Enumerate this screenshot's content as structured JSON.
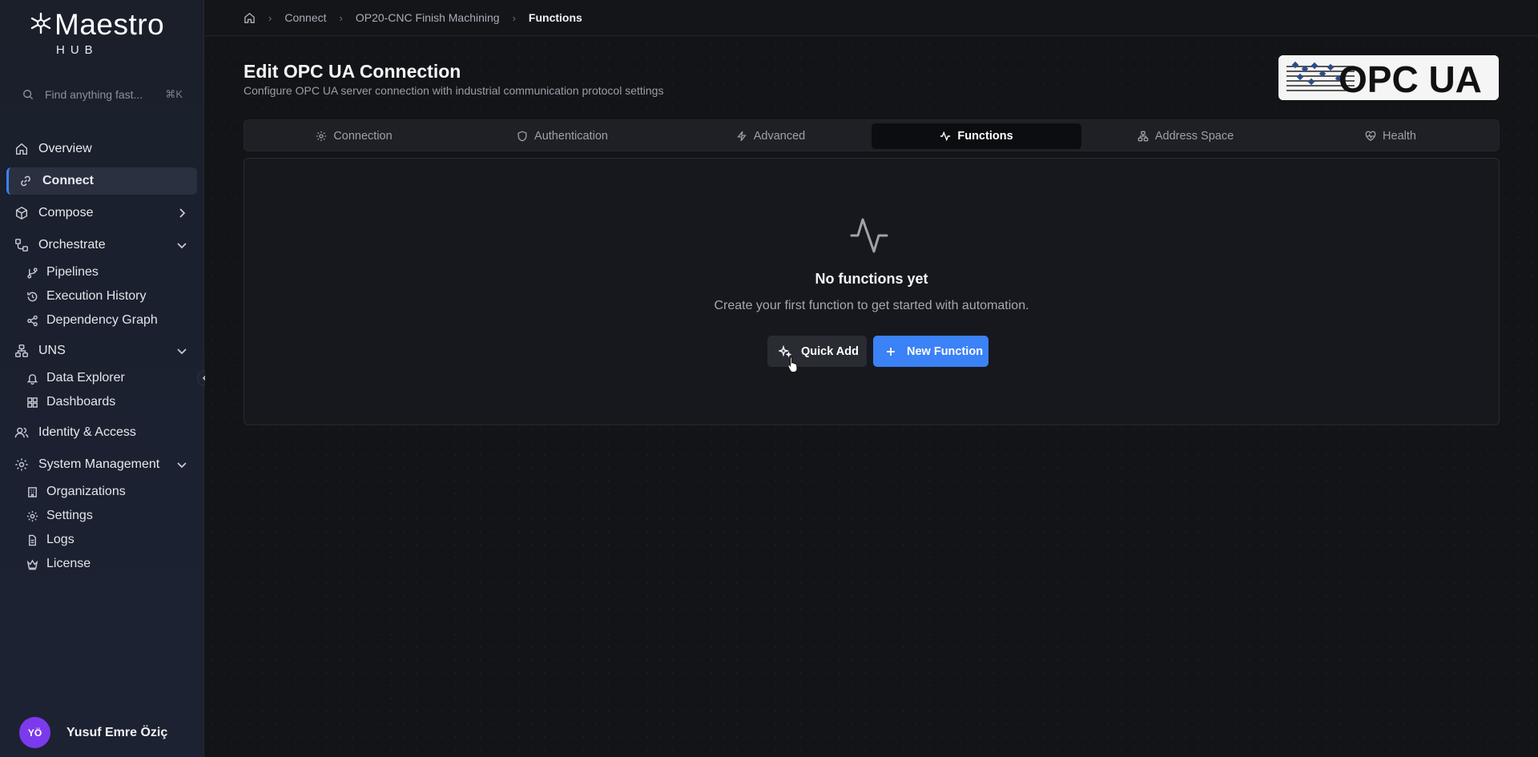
{
  "app": {
    "logo_text": "Maestro",
    "logo_sub": "HUB"
  },
  "search": {
    "placeholder": "Find anything fast...",
    "shortcut": "⌘K"
  },
  "sidebar": {
    "items": [
      {
        "label": "Overview",
        "icon": "home-icon"
      },
      {
        "label": "Connect",
        "icon": "link-icon",
        "active": true
      },
      {
        "label": "Compose",
        "icon": "cube-icon",
        "chevron": "right"
      },
      {
        "label": "Orchestrate",
        "icon": "workflow-icon",
        "chevron": "down",
        "children": [
          {
            "label": "Pipelines",
            "icon": "git-branch-icon"
          },
          {
            "label": "Execution History",
            "icon": "history-icon"
          },
          {
            "label": "Dependency Graph",
            "icon": "share-icon"
          }
        ]
      },
      {
        "label": "UNS",
        "icon": "network-icon",
        "chevron": "down",
        "children": [
          {
            "label": "Data Explorer",
            "icon": "bell-icon"
          },
          {
            "label": "Dashboards",
            "icon": "grid-icon"
          }
        ]
      },
      {
        "label": "Identity & Access",
        "icon": "users-icon"
      },
      {
        "label": "System Management",
        "icon": "gear-icon",
        "chevron": "down",
        "children": [
          {
            "label": "Organizations",
            "icon": "building-icon"
          },
          {
            "label": "Settings",
            "icon": "cog-icon"
          },
          {
            "label": "Logs",
            "icon": "file-icon"
          },
          {
            "label": "License",
            "icon": "crown-icon"
          }
        ]
      }
    ]
  },
  "user": {
    "initials": "YÖ",
    "name": "Yusuf Emre Öziç",
    "avatar_color": "#7c3aed"
  },
  "breadcrumb": [
    "Connect",
    "OP20-CNC Finish Machining",
    "Functions"
  ],
  "header": {
    "title": "Edit OPC UA Connection",
    "subtitle": "Configure OPC UA server connection with industrial communication protocol settings",
    "logo_text": "OPC UA"
  },
  "tabs": [
    {
      "label": "Connection",
      "icon": "gear-icon"
    },
    {
      "label": "Authentication",
      "icon": "shield-icon"
    },
    {
      "label": "Advanced",
      "icon": "zap-icon"
    },
    {
      "label": "Functions",
      "icon": "activity-icon",
      "active": true
    },
    {
      "label": "Address Space",
      "icon": "network-icon"
    },
    {
      "label": "Health",
      "icon": "heart-pulse-icon"
    }
  ],
  "empty_state": {
    "title": "No functions yet",
    "description": "Create your first function to get started with automation.",
    "quick_add_label": "Quick Add",
    "new_function_label": "New Function"
  },
  "colors": {
    "accent": "#3b82f6",
    "background": "#131418",
    "sidebar": "#1b2130"
  }
}
